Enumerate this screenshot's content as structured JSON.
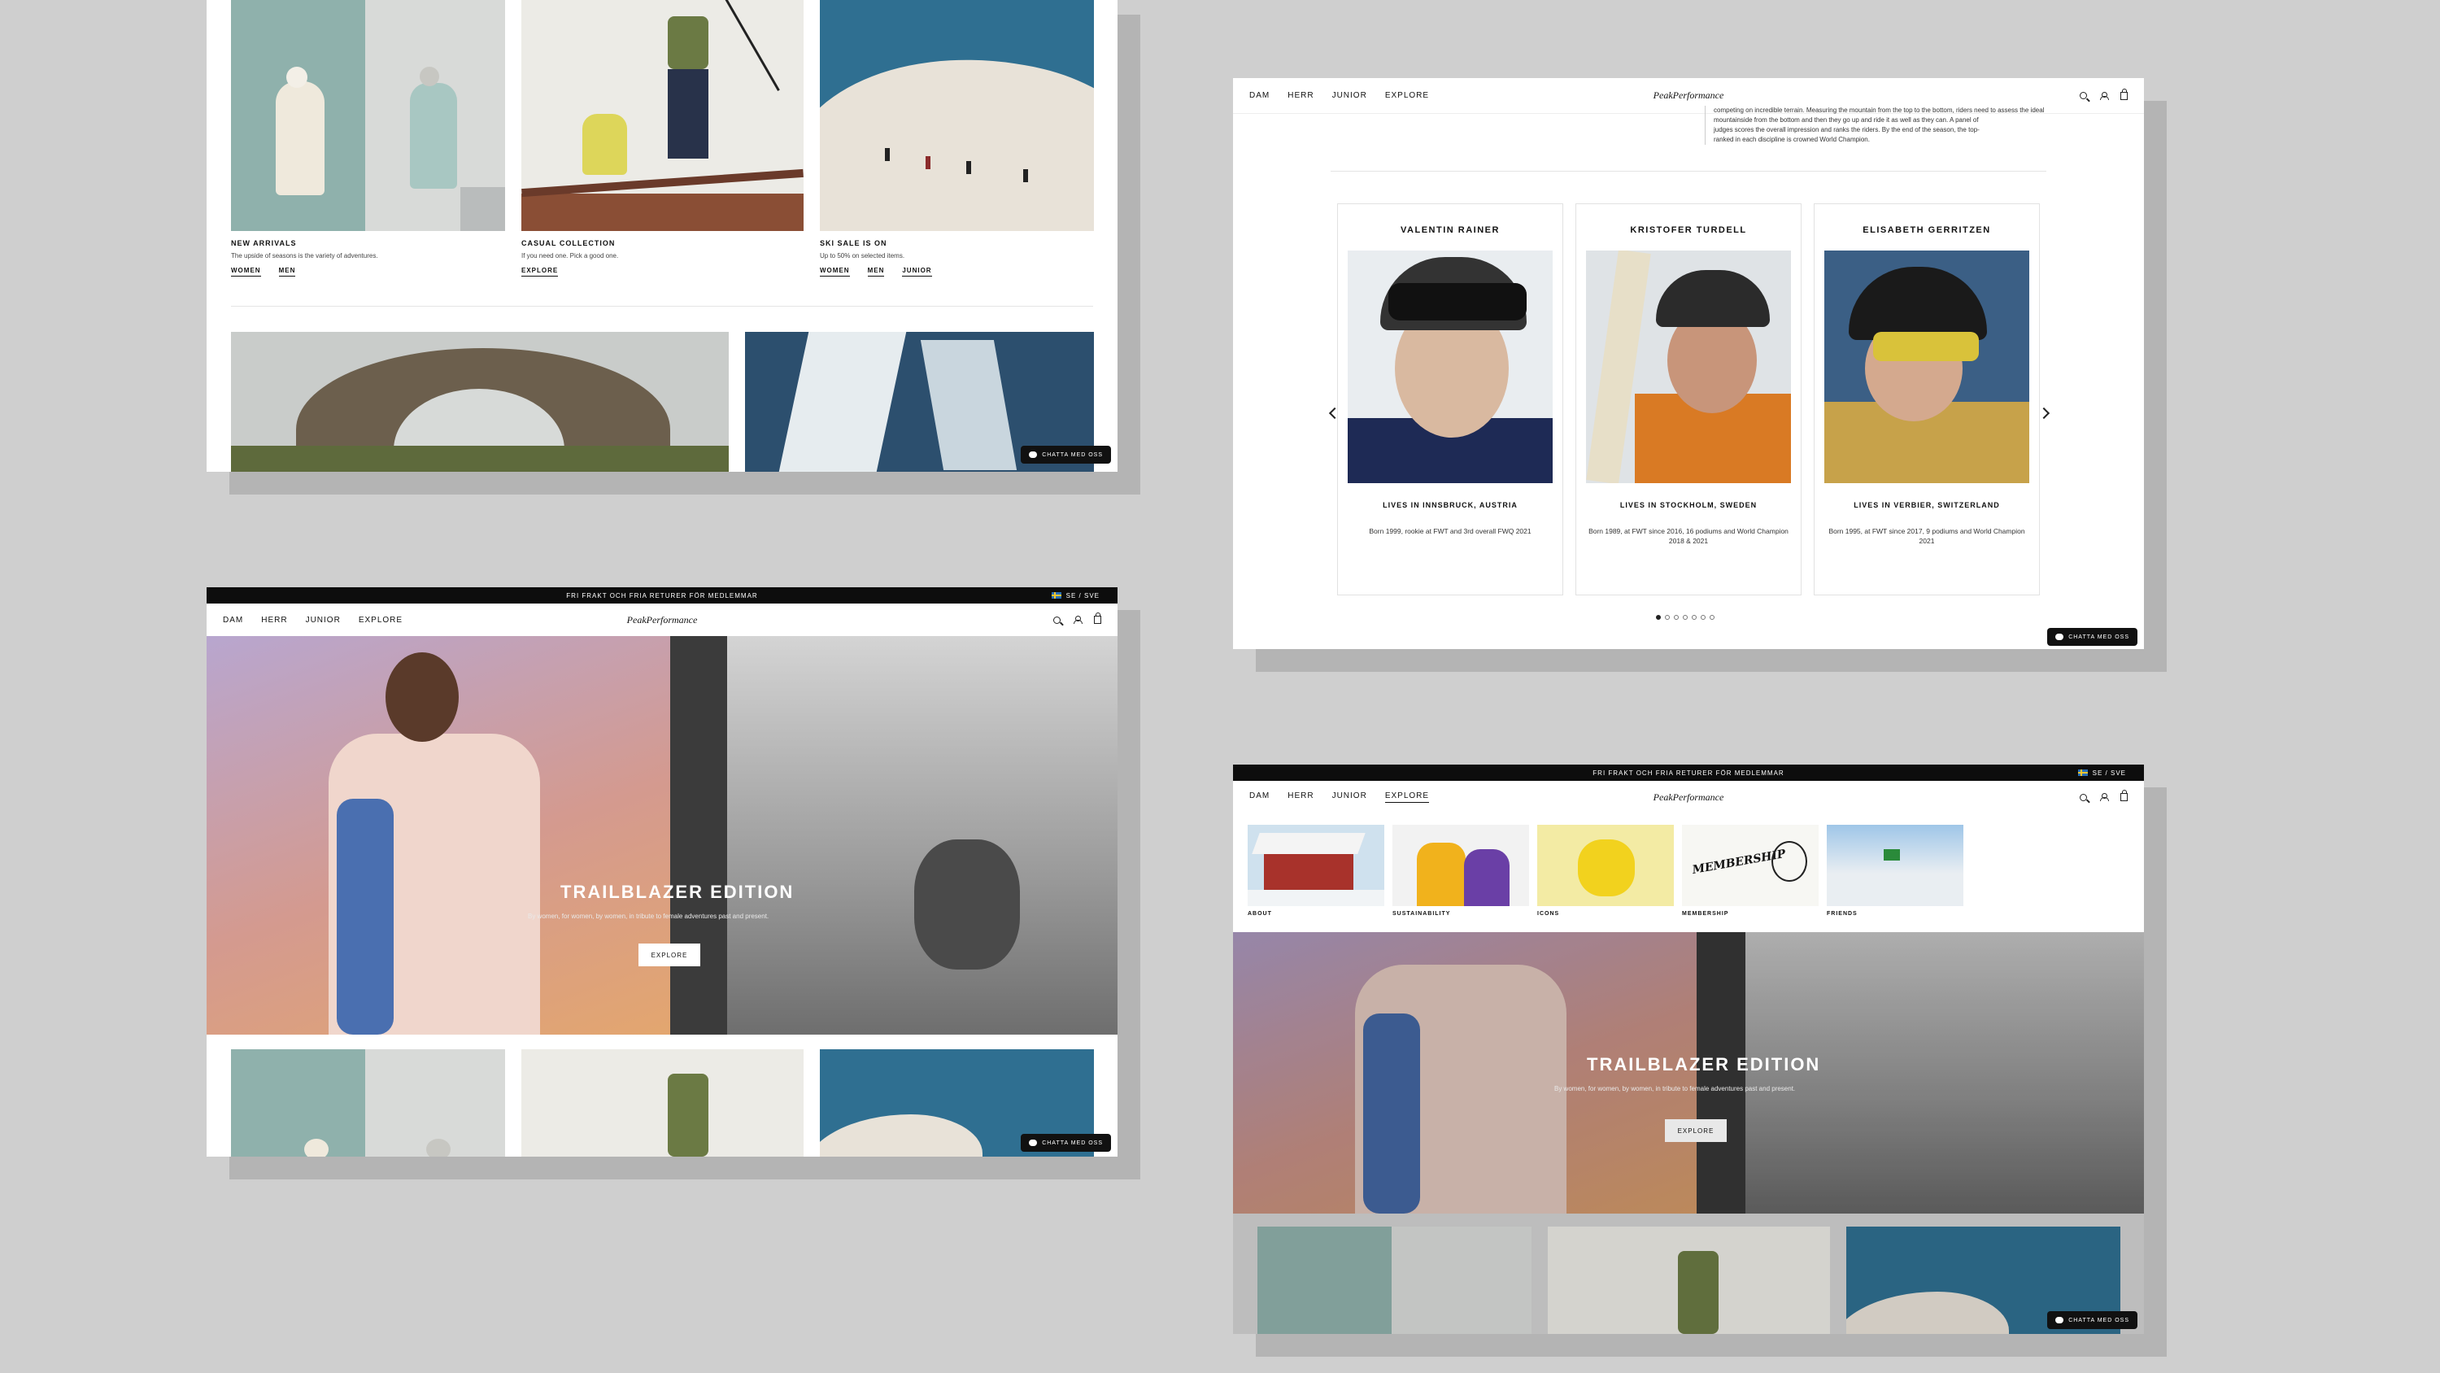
{
  "nav": {
    "items": [
      "DAM",
      "HERR",
      "JUNIOR",
      "EXPLORE"
    ],
    "logo": "PeakPerformance"
  },
  "promo_bar": {
    "text": "FRI FRAKT OCH FRIA RETURER FÖR MEDLEMMAR",
    "locale": "SE / SVE"
  },
  "chat_label": "CHATTA MED OSS",
  "categories": [
    {
      "title": "NEW ARRIVALS",
      "desc": "The upside of seasons is the variety of adventures.",
      "links": [
        "WOMEN",
        "MEN"
      ]
    },
    {
      "title": "CASUAL COLLECTION",
      "desc": "If you need one. Pick a good one.",
      "links": [
        "EXPLORE"
      ]
    },
    {
      "title": "SKI SALE IS ON",
      "desc": "Up to 50% on selected items.",
      "links": [
        "WOMEN",
        "MEN",
        "JUNIOR"
      ]
    }
  ],
  "hero": {
    "title": "TRAILBLAZER EDITION",
    "subtitle": "By women, for women, by women, in tribute to female adventures past and present.",
    "button": "EXPLORE"
  },
  "intro_text": [
    "competing on incredible terrain. Measuring the mountain from the top to the bottom, riders need to assess the ideal",
    "mountainside from the bottom and then they go up and ride it as well as they can. A panel of",
    "judges scores the overall impression and ranks the riders. By the end of the season, the top-",
    "ranked in each discipline is crowned World Champion."
  ],
  "athletes": [
    {
      "name": "VALENTIN RAINER",
      "lives": "LIVES IN INNSBRUCK, AUSTRIA",
      "bio": "Born 1999, rookie at FWT and 3rd overall FWQ 2021"
    },
    {
      "name": "KRISTOFER TURDELL",
      "lives": "LIVES IN STOCKHOLM, SWEDEN",
      "bio": "Born 1989, at FWT since 2016, 16 podiums and World Champion 2018 & 2021"
    },
    {
      "name": "ELISABETH GERRITZEN",
      "lives": "LIVES IN VERBIER, SWITZERLAND",
      "bio": "Born 1995, at FWT since 2017, 9 podiums and World Champion 2021"
    }
  ],
  "carousel": {
    "pages": 7,
    "active": 1
  },
  "explore_tiles": [
    "ABOUT",
    "SUSTAINABILITY",
    "ICONS",
    "MEMBERSHIP",
    "FRIENDS"
  ],
  "membership_sketch_text": "MEMBERSHIP"
}
